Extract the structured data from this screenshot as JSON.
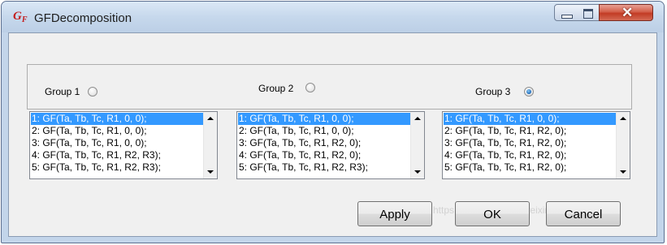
{
  "window": {
    "title": "GFDecomposition",
    "icon_text": "G",
    "icon_subscript": "F"
  },
  "groups": [
    {
      "label": "Group 1",
      "selected": false
    },
    {
      "label": "Group 2",
      "selected": false
    },
    {
      "label": "Group 3",
      "selected": true
    }
  ],
  "lists": [
    {
      "items": [
        "1: GF(Ta, Tb, Tc, R1, 0, 0);",
        "2: GF(Ta, Tb, Tc, R1, 0, 0);",
        "3: GF(Ta, Tb, Tc, R1, 0, 0);",
        "4: GF(Ta, Tb, Tc, R1, R2, R3);",
        "5: GF(Ta, Tb, Tc, R1, R2, R3);"
      ],
      "selected_index": 0
    },
    {
      "items": [
        "1: GF(Ta, Tb, Tc, R1, 0, 0);",
        "2: GF(Ta, Tb, Tc, R1, 0, 0);",
        "3: GF(Ta, Tb, Tc, R1, R2, 0);",
        "4: GF(Ta, Tb, Tc, R1, R2, 0);",
        "5: GF(Ta, Tb, Tc, R1, R2, R3);"
      ],
      "selected_index": 0
    },
    {
      "items": [
        "1: GF(Ta, Tb, Tc, R1, 0, 0);",
        "2: GF(Ta, Tb, Tc, R1, R2, 0);",
        "3: GF(Ta, Tb, Tc, R1, R2, 0);",
        "4: GF(Ta, Tb, Tc, R1, R2, 0);",
        "5: GF(Ta, Tb, Tc, R1, R2, 0);"
      ],
      "selected_index": 0
    }
  ],
  "buttons": {
    "apply": "Apply",
    "ok": "OK",
    "cancel": "Cancel"
  },
  "watermark": "https://blog.csdn.net/weixin_41865010",
  "colors": {
    "selection": "#3399ff",
    "close_button": "#c23b24",
    "titlebar": "#c6d8ec"
  }
}
